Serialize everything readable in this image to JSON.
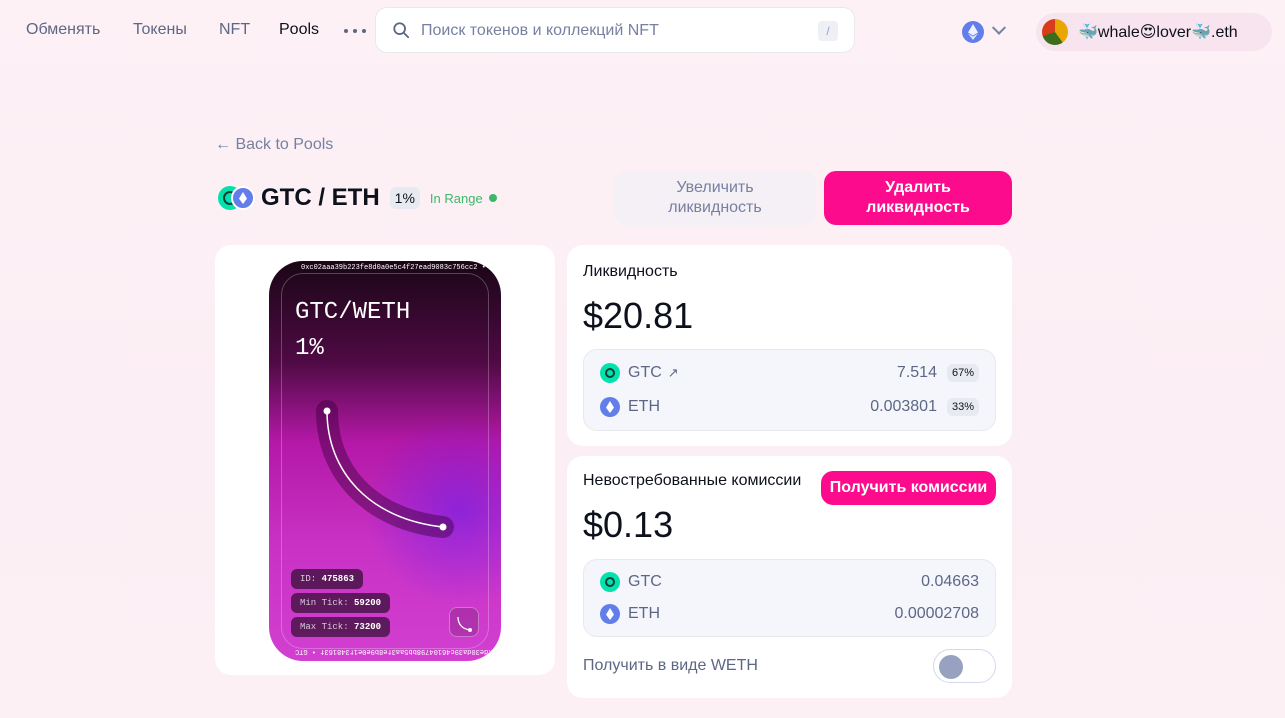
{
  "nav": {
    "items": [
      "Обменять",
      "Токены",
      "NFT",
      "Pools"
    ],
    "active": "Pools",
    "search_placeholder": "Поиск токенов и коллекций NFT",
    "search_shortcut": "/",
    "account_name": "🐳whale😍lover🐳.eth"
  },
  "header": {
    "back_label": "← Back to Pools",
    "pair_name": "GTC / ETH",
    "fee_tier": "1%",
    "range_status": "In Range",
    "increase_label_line1": "Увеличить",
    "increase_label_line2": "ликвидность",
    "remove_label_line1": "Удалить",
    "remove_label_line2": "ликвидность"
  },
  "nft": {
    "title_line1": "GTC/WETH",
    "title_line2": "1%",
    "address_top": "0xc02aaa39b223fe8d0a0e5c4f27ead9083c756cc2 • WETH",
    "address_bottom": "0xde30da39c46104798bb5aa3fe8b9e0e1f348163f • GTC",
    "id_label": "ID:",
    "id_value": "475863",
    "min_tick_label": "Min Tick:",
    "min_tick_value": "59200",
    "max_tick_label": "Max Tick:",
    "max_tick_value": "73200"
  },
  "liquidity": {
    "label": "Ликвидность",
    "total": "$20.81",
    "tokens": [
      {
        "symbol": "GTC",
        "amount": "7.514",
        "percent": "67%"
      },
      {
        "symbol": "ETH",
        "amount": "0.003801",
        "percent": "33%"
      }
    ]
  },
  "fees": {
    "label": "Невостребованные комиссии",
    "total": "$0.13",
    "collect_label": "Получить комиссии",
    "tokens": [
      {
        "symbol": "GTC",
        "amount": "0.04663"
      },
      {
        "symbol": "ETH",
        "amount": "0.00002708"
      }
    ],
    "weth_label": "Получить в виде WETH",
    "weth_enabled": false
  },
  "colors": {
    "accent": "#fc0c8d",
    "in_range": "#40b66b",
    "gtc": "#02e2ac",
    "eth": "#627eea"
  }
}
